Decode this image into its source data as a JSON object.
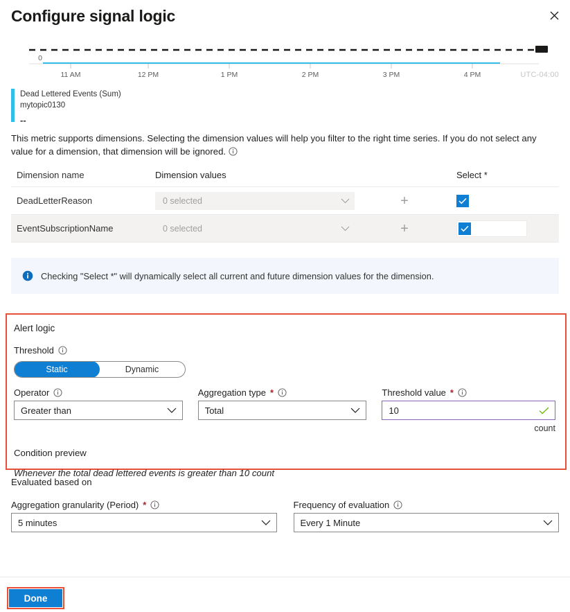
{
  "header": {
    "title": "Configure signal logic",
    "close_icon": "close-icon"
  },
  "chart": {
    "timezone_label": "UTC-04:00",
    "y_zero_label": "0",
    "legend": {
      "metric_title": "Dead Lettered Events (Sum)",
      "resource": "mytopic0130",
      "value": "--",
      "color": "#32bdea"
    },
    "chart_data": {
      "type": "line",
      "title": "Dead Lettered Events (Sum)",
      "subtitle": "mytopic0130",
      "xlabel": "",
      "ylabel": "",
      "x_tick_labels": [
        "11 AM",
        "12 PM",
        "1 PM",
        "2 PM",
        "3 PM",
        "4 PM"
      ],
      "y_tick_labels": [
        "0"
      ],
      "ylim": [
        0,
        10
      ],
      "grid": false,
      "legend_position": "below",
      "timezone": "UTC-04:00",
      "series": [
        {
          "name": "Dead Lettered Events (Sum)",
          "type": "line",
          "color": "#32bdea",
          "values": [
            0,
            0,
            0,
            0,
            0,
            0
          ]
        },
        {
          "name": "Threshold",
          "type": "dashed-line",
          "color": "#000000",
          "value": 10,
          "marker_label": ""
        }
      ]
    }
  },
  "description": {
    "text": "This metric supports dimensions. Selecting the dimension values will help you filter to the right time series. If you do not select any value for a dimension, that dimension will be ignored.",
    "info_icon": "info-icon"
  },
  "dimensions_table": {
    "headers": {
      "name": "Dimension name",
      "values": "Dimension values",
      "select": "Select *"
    },
    "rows": [
      {
        "name": "DeadLetterReason",
        "values_placeholder": "0 selected",
        "add_icon": "plus-icon",
        "checked": true,
        "focused": false
      },
      {
        "name": "EventSubscriptionName",
        "values_placeholder": "0 selected",
        "add_icon": "plus-icon",
        "checked": true,
        "focused": true
      }
    ]
  },
  "info_banner": {
    "icon": "info-filled-icon",
    "text": "Checking \"Select *\" will dynamically select all current and future dimension values for the dimension.",
    "background": "#f3f7fd"
  },
  "alert_logic": {
    "section_title": "Alert logic",
    "highlight_color": "#e8503a",
    "threshold": {
      "label": "Threshold",
      "info_icon": "info-icon",
      "options": [
        "Static",
        "Dynamic"
      ],
      "selected": "Static"
    },
    "operator": {
      "label": "Operator",
      "info_icon": "info-icon",
      "value": "Greater than",
      "chevron_icon": "chevron-down-icon"
    },
    "aggregation_type": {
      "label": "Aggregation type",
      "required": "*",
      "info_icon": "info-icon",
      "value": "Total",
      "chevron_icon": "chevron-down-icon"
    },
    "threshold_value": {
      "label": "Threshold value",
      "required": "*",
      "info_icon": "info-icon",
      "value": "10",
      "placeholder": "",
      "unit": "count",
      "valid_icon": "checkmark-icon",
      "border_color": "#8764b8"
    },
    "condition_preview": {
      "label": "Condition preview",
      "text": "Whenever the total dead lettered events is greater than 10 count"
    }
  },
  "evaluated_based_on": {
    "title": "Evaluated based on",
    "granularity": {
      "label": "Aggregation granularity (Period)",
      "required": "*",
      "info_icon": "info-icon",
      "value": "5 minutes",
      "chevron_icon": "chevron-down-icon"
    },
    "frequency": {
      "label": "Frequency of evaluation",
      "info_icon": "info-icon",
      "value": "Every 1 Minute",
      "chevron_icon": "chevron-down-icon"
    }
  },
  "footer": {
    "done_label": "Done",
    "highlight_color": "#e8503a",
    "button_color": "#0f7fd4"
  }
}
